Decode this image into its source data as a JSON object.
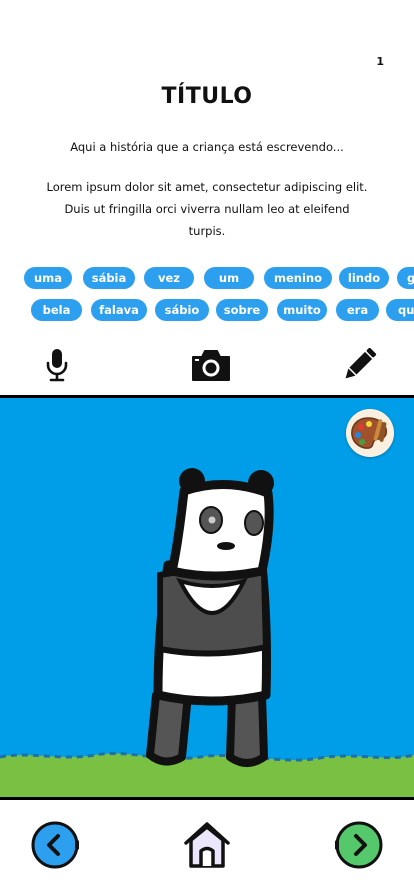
{
  "page": {
    "number": "1"
  },
  "story": {
    "title": "TÍTULO",
    "intro": "Aqui a história que a criança está escrevendo...",
    "body": "Lorem ipsum dolor sit amet, consectetur adipiscing elit. Duis ut fringilla orci viverra nullam leo at eleifend turpis."
  },
  "word_chips": {
    "row1": [
      "uma",
      "sábia",
      "vez",
      "um",
      "menino",
      "lindo",
      "g"
    ],
    "row2": [
      "bela",
      "falava",
      "sábio",
      "sobre",
      "muito",
      "era",
      "qu"
    ]
  },
  "toolbar": {
    "icons": [
      "microphone-icon",
      "camera-icon",
      "pencil-icon"
    ]
  },
  "drawing": {
    "subject_icon": "panda-drawing",
    "palette_icon": "paint-palette-icon",
    "colors": {
      "sky": "#009ee8",
      "grass": "#7ac143",
      "ink": "#1a1a1a"
    }
  },
  "navigation": {
    "icons": [
      "back-arrow-icon",
      "home-icon",
      "forward-arrow-icon"
    ],
    "colors": {
      "back": "#2c9fef",
      "home": "#ece6fb",
      "forward": "#55c86c"
    }
  }
}
